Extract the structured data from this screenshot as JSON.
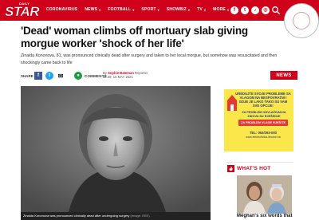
{
  "header": {
    "logo_daily": "DAILY",
    "logo_star": "STAR",
    "nav": [
      {
        "label": "CORONAVIRUS",
        "has_dropdown": false
      },
      {
        "label": "NEWS",
        "has_dropdown": true
      },
      {
        "label": "FOOTBALL",
        "has_dropdown": true
      },
      {
        "label": "SPORT",
        "has_dropdown": true
      },
      {
        "label": "SHOWBIZ",
        "has_dropdown": true
      },
      {
        "label": "TV",
        "has_dropdown": true
      },
      {
        "label": "MORE",
        "has_dropdown": true
      }
    ],
    "social": [
      {
        "name": "facebook-icon",
        "glyph": "f"
      },
      {
        "name": "twitter-icon",
        "glyph": "t"
      },
      {
        "name": "tiktok-icon",
        "glyph": "♪"
      },
      {
        "name": "instagram-icon",
        "glyph": "◎"
      }
    ],
    "brand_color": "#d0021b"
  },
  "article": {
    "headline": "'Dead' woman climbs off mortuary slab giving morgue worker 'shock of her life'",
    "standfirst": "Zinaida Kononova, 81, was pronounced clinically dead after surgery and taken to her local morgue, but somehow was resuscitated and then shockingly came back to life",
    "share_label": "SHARE",
    "comments_label": "COMMENTS",
    "byline_prefix": "By",
    "author": "Sophie Bateman",
    "author_role": "Reporter",
    "date": "19:49, 15 MAY 2021",
    "section_badge": "NEWS",
    "caption": "Zinaida Kononova was pronounced clinically dead after undergoing surgery",
    "caption_source": "(Image: EEE)"
  },
  "ad": {
    "line1": "UREDUJTE SVOJE PROBLEME SA VLAGOM NA BESPOVRATNI I GDJE JE LAKO TAKO SU VAM SVE OPCIJE:",
    "line2": "ZA PROBLEM ODVLAŽIVANJA ZIDOVA SU RJEŠENJE",
    "button": "ZA PROBLEM VLAGE RJEŠITE",
    "phone": "TEL: 063/393-000",
    "url": "www.elektrofizika-ilinoise.ba"
  },
  "whats_hot": {
    "title": "WHAT'S HOT",
    "caption": "Meghan's six words that"
  }
}
